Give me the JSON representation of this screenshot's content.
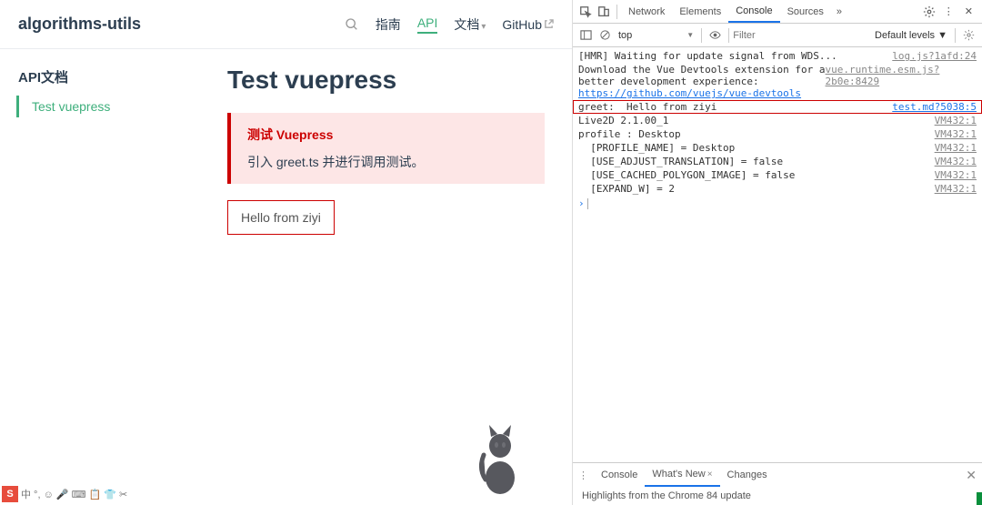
{
  "nav": {
    "title": "algorithms-utils",
    "items": [
      {
        "label": "指南",
        "active": false,
        "dropdown": false
      },
      {
        "label": "API",
        "active": true,
        "dropdown": false
      },
      {
        "label": "文档",
        "active": false,
        "dropdown": true
      },
      {
        "label": "GitHub",
        "active": false,
        "external": true
      }
    ]
  },
  "sidebar": {
    "heading": "API文档",
    "items": [
      {
        "label": "Test vuepress",
        "active": true
      }
    ]
  },
  "content": {
    "h1": "Test vuepress",
    "tip_title": "测试 Vuepress",
    "tip_body": "引入 greet.ts 并进行调用测试。",
    "output": "Hello from ziyi"
  },
  "devtools": {
    "tabs": [
      "Network",
      "Elements",
      "Console",
      "Sources"
    ],
    "active_tab": "Console",
    "more": "»",
    "toolbar": {
      "context": "top",
      "filter_placeholder": "Filter",
      "levels": "Default levels ▼"
    },
    "logs": [
      {
        "msg": "[HMR] Waiting for update signal from WDS...",
        "src": "log.js?1afd:24",
        "indent": 0
      },
      {
        "msg": "Download the Vue Devtools extension for a\nbetter development experience:\nhttps://github.com/vuejs/vue-devtools",
        "src": "vue.runtime.esm.js?2b0e:8429",
        "indent": 0,
        "link": true
      },
      {
        "msg": "greet:  Hello from ziyi",
        "src": "test.md?5038:5",
        "indent": 0,
        "highlight": true
      },
      {
        "msg": "Live2D 2.1.00_1",
        "src": "VM432:1",
        "indent": 0
      },
      {
        "msg": "profile : Desktop",
        "src": "VM432:1",
        "indent": 0
      },
      {
        "msg": "  [PROFILE_NAME] = Desktop",
        "src": "VM432:1",
        "indent": 1
      },
      {
        "msg": "  [USE_ADJUST_TRANSLATION] = false",
        "src": "VM432:1",
        "indent": 1
      },
      {
        "msg": "  [USE_CACHED_POLYGON_IMAGE] = false",
        "src": "VM432:1",
        "indent": 1
      },
      {
        "msg": "  [EXPAND_W] = 2",
        "src": "VM432:1",
        "indent": 1
      }
    ],
    "prompt": "›",
    "drawer": {
      "tabs": [
        "Console",
        "What's New",
        "Changes"
      ],
      "active": "What's New",
      "body": "Highlights from the Chrome 84 update"
    }
  },
  "ime": {
    "badge": "S",
    "icons": "中 °, ☺ 🎤 ⌨ 📋 👕 ✂"
  }
}
